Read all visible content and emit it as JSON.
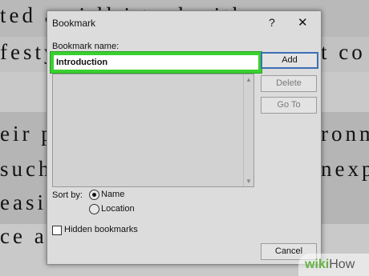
{
  "background": {
    "lines": [
      "ted a   ai   ll   i   t   ed with",
      "festy",
      "t  co",
      "eir  p",
      "ronm",
      "such t",
      "nexp",
      "easie",
      "ce a f"
    ]
  },
  "dialog": {
    "title": "Bookmark",
    "help_label": "?",
    "close_label": "✕",
    "name_label": "Bookmark name:",
    "name_value": "Introduction",
    "buttons": {
      "add": "Add",
      "delete": "Delete",
      "goto": "Go To",
      "cancel": "Cancel"
    },
    "sort_by_label": "Sort by:",
    "sort_options": [
      "Name",
      "Location"
    ],
    "sort_selected": "Name",
    "hidden_bookmarks_label": "Hidden bookmarks",
    "hidden_bookmarks_checked": false
  },
  "watermark": {
    "prefix": "wiki",
    "suffix": "How"
  },
  "colors": {
    "highlight": "#39d12f",
    "primary_border": "#3c6fb5"
  }
}
